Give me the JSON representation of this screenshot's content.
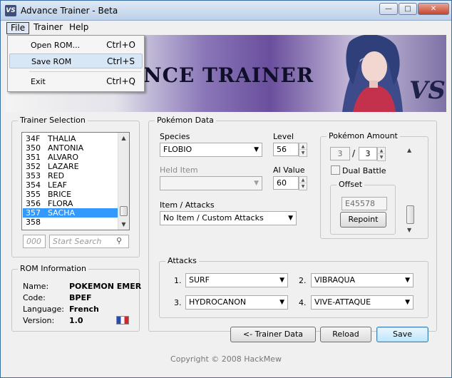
{
  "window": {
    "title": "Advance Trainer - Beta",
    "icon_text": "VS",
    "controls": {
      "minimize": "—",
      "maximize": "□",
      "close": "✕"
    }
  },
  "menu": {
    "items": [
      "File",
      "Trainer",
      "Help"
    ],
    "file_dropdown": [
      {
        "label": "Open ROM...",
        "shortcut": "Ctrl+O"
      },
      {
        "label": "Save ROM",
        "shortcut": "Ctrl+S"
      },
      {
        "label": "Exit",
        "shortcut": "Ctrl+Q"
      }
    ]
  },
  "banner": {
    "title_text": "NCE TRAINER",
    "badge": "VS"
  },
  "trainer_selection": {
    "label": "Trainer Selection",
    "trainers": [
      {
        "id": "34F",
        "name": "THALIA"
      },
      {
        "id": "350",
        "name": "ANTONIA"
      },
      {
        "id": "351",
        "name": "ALVARO"
      },
      {
        "id": "352",
        "name": "LAZARE"
      },
      {
        "id": "353",
        "name": "RED"
      },
      {
        "id": "354",
        "name": "LEAF"
      },
      {
        "id": "355",
        "name": "BRICE"
      },
      {
        "id": "356",
        "name": "FLORA"
      },
      {
        "id": "357",
        "name": "SACHA"
      },
      {
        "id": "358",
        "name": ""
      }
    ],
    "selected_index": 8,
    "number_placeholder": "000",
    "search_placeholder": "Start Search"
  },
  "rom_info": {
    "label": "ROM Information",
    "rows": [
      {
        "key": "Name:",
        "value": "POKEMON EMER"
      },
      {
        "key": "Code:",
        "value": "BPEF"
      },
      {
        "key": "Language:",
        "value": "French"
      },
      {
        "key": "Version:",
        "value": "1.0"
      }
    ]
  },
  "pokemon_data": {
    "label": "Pokémon Data",
    "species_label": "Species",
    "species_value": "FLOBIO",
    "level_label": "Level",
    "level_value": "56",
    "held_item_label": "Held Item",
    "held_item_value": "",
    "ai_label": "AI Value",
    "ai_value": "60",
    "item_attacks_label": "Item / Attacks",
    "item_attacks_value": "No Item / Custom Attacks",
    "amount": {
      "label": "Pokémon Amount",
      "current": "3",
      "separator": "/",
      "total": "3",
      "dual_battle_label": "Dual Battle",
      "dual_battle_checked": false,
      "offset_label": "Offset",
      "offset_value": "E45578",
      "repoint_label": "Repoint"
    },
    "attacks": {
      "label": "Attacks",
      "slots": [
        {
          "num": "1.",
          "value": "SURF"
        },
        {
          "num": "2.",
          "value": "VIBRAQUA"
        },
        {
          "num": "3.",
          "value": "HYDROCANON"
        },
        {
          "num": "4.",
          "value": "VIVE-ATTAQUE"
        }
      ]
    }
  },
  "buttons": {
    "trainer_data": "<- Trainer Data",
    "reload": "Reload",
    "save": "Save"
  },
  "footer": {
    "copyright": "Copyright © 2008 HackMew"
  }
}
